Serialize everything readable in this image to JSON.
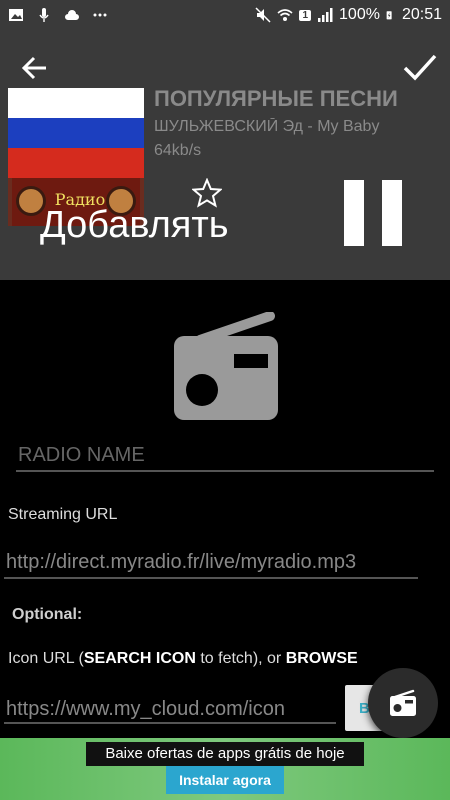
{
  "status_bar": {
    "battery": "100%",
    "time": "20:51",
    "sim_badge": "1",
    "icons": [
      "image-icon",
      "mic-icon",
      "cloud-icon",
      "more-dots-icon",
      "mute-icon",
      "wifi-icon",
      "signal-icon",
      "battery-charging-icon"
    ]
  },
  "header": {
    "song_title": "ПОПУЛЯРНЫЕ ПЕСНИ",
    "song_artist": "ШУЛЬЖЕВСКИЙ Эд - My Baby",
    "bitrate": "64kb/s",
    "logo_text": "Радио",
    "add_label": "Добавлять"
  },
  "form": {
    "name_placeholder": "RADIO NAME",
    "streaming_label": "Streaming URL",
    "streaming_placeholder": "http://direct.myradio.fr/live/myradio.mp3",
    "optional_label": "Optional:",
    "icon_label_prefix": "Icon URL (",
    "icon_label_search": "SEARCH ICON",
    "icon_label_mid": " to fetch), or ",
    "icon_label_browse": "BROWSE",
    "icon_placeholder": "https://www.my_cloud.com/icon",
    "browse_button": "BR"
  },
  "ad": {
    "text": "Baixe ofertas de apps grátis de hoje",
    "button": "Instalar agora"
  },
  "colors": {
    "header_bg": "#3a3a3a",
    "ad_green": "#6cc06b",
    "ad_button": "#2ba6cf",
    "browse_text": "#39b0c8"
  }
}
